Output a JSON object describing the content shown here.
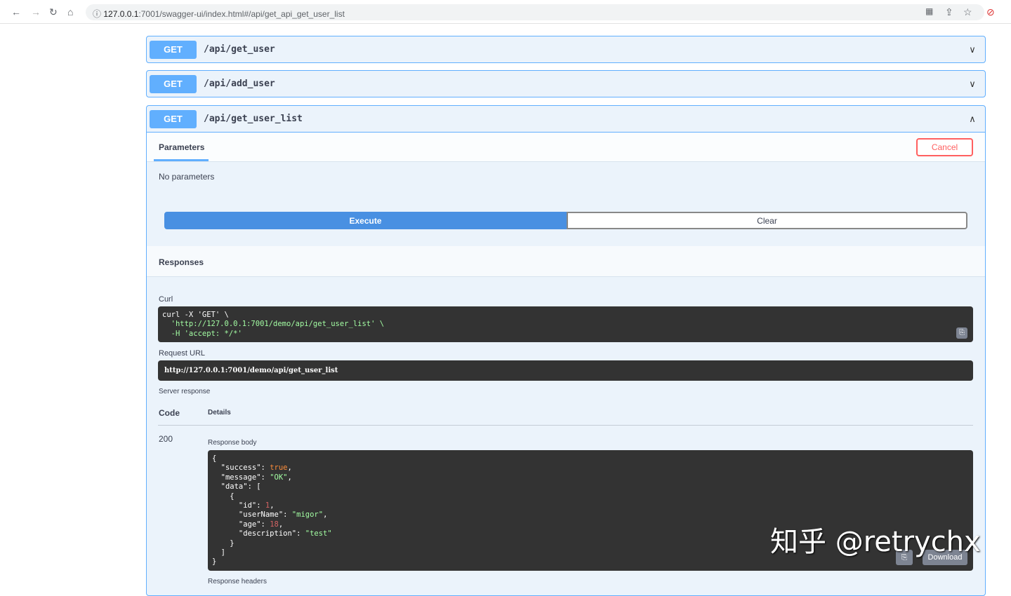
{
  "browser": {
    "url_host": "127.0.0.1",
    "url_rest": ":7001/swagger-ui/index.html#/api/get_api_get_user_list"
  },
  "operations": [
    {
      "method": "GET",
      "path": "/api/get_user",
      "expanded": false
    },
    {
      "method": "GET",
      "path": "/api/add_user",
      "expanded": false
    },
    {
      "method": "GET",
      "path": "/api/get_user_list",
      "expanded": true
    }
  ],
  "detail": {
    "parameters_tab": "Parameters",
    "cancel": "Cancel",
    "no_params": "No parameters",
    "execute": "Execute",
    "clear": "Clear",
    "responses": "Responses",
    "curl_label": "Curl",
    "curl_lines": [
      "curl -X 'GET' \\",
      "  'http://127.0.0.1:7001/demo/api/get_user_list' \\",
      "  -H 'accept: */*'"
    ],
    "request_url_label": "Request URL",
    "request_url": "http://127.0.0.1:7001/demo/api/get_user_list",
    "server_response": "Server response",
    "code_header": "Code",
    "details_header": "Details",
    "code": "200",
    "response_body_label": "Response body",
    "download": "Download",
    "response_headers_label": "Response headers"
  },
  "response_body": {
    "success": "true",
    "message": "\"OK\"",
    "id": "1",
    "userName": "\"migor\"",
    "age": "18",
    "description": "\"test\""
  },
  "watermark": "知乎 @retrychx"
}
